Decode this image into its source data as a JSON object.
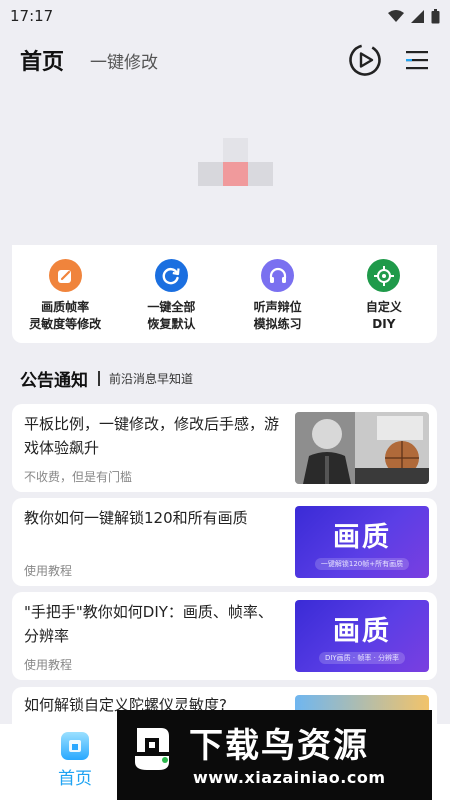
{
  "status_bar": {
    "time": "17:17",
    "icons": [
      "wifi-icon",
      "signal-icon",
      "battery-icon"
    ]
  },
  "header": {
    "title": "首页",
    "subtitle": "一键修改",
    "icons": [
      "play-circle-icon",
      "menu-icon"
    ]
  },
  "tools": [
    {
      "label_line1": "画质帧率",
      "label_line2": "灵敏度等修改",
      "icon": "edit-icon",
      "color": "#f0843c"
    },
    {
      "label_line1": "一键全部",
      "label_line2": "恢复默认",
      "icon": "refresh-icon",
      "color": "#1b6fe0"
    },
    {
      "label_line1": "听声辩位",
      "label_line2": "模拟练习",
      "icon": "headphones-icon",
      "color": "#7a70f0"
    },
    {
      "label_line1": "自定义",
      "label_line2": "DIY",
      "icon": "crosshair-icon",
      "color": "#1f9a4a"
    }
  ],
  "notice": {
    "title": "公告通知",
    "subtitle": "前沿消息早知道"
  },
  "articles": [
    {
      "title": "平板比例，一键修改，修改后手感，游戏体验飙升",
      "sub": "不收费，但是有门槛",
      "thumb": "photo"
    },
    {
      "title": "教你如何一键解锁120和所有画质",
      "sub": "使用教程",
      "thumb_big": "画质",
      "thumb_small": "一键解锁120帧+所有画质"
    },
    {
      "title": "\"手把手\"教你如何DIY：画质、帧率、分辨率",
      "sub": "使用教程",
      "thumb_big": "画质",
      "thumb_small": "DIY画质 · 帧率 · 分辨率"
    },
    {
      "title": "如何解锁自定义陀螺仪灵敏度?"
    }
  ],
  "bottom_nav": {
    "home_label": "首页"
  },
  "watermark": {
    "title": "下载鸟资源",
    "url": "www.xiazainiao.com"
  },
  "colors": {
    "accent": "#1fa3f2",
    "background": "#eeeef3"
  }
}
